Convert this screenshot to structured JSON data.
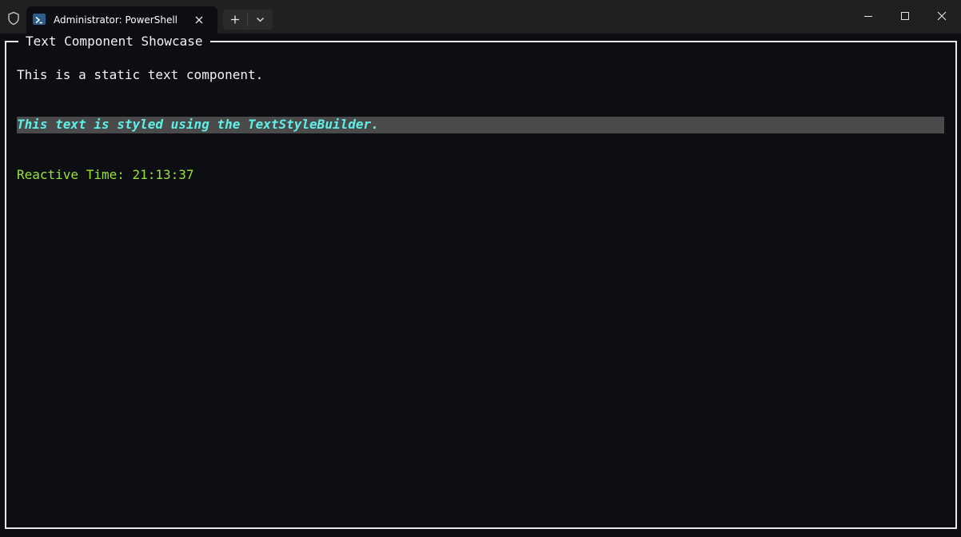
{
  "window": {
    "tab_title": "Administrator: PowerShell",
    "tab_icon": "powershell-icon",
    "controls": [
      "minimize-icon",
      "maximize-icon",
      "close-icon"
    ]
  },
  "terminal": {
    "frame_title": "Text Component Showcase",
    "static_text": "This is a static text component.",
    "styled_text": "This text is styled using the TextStyleBuilder.",
    "reactive_time": "Reactive Time: 21:13:37"
  },
  "colors": {
    "background": "#0c0e14",
    "titlebar": "#202020",
    "static_text": "#f2f2f2",
    "styled_text": "#5ef0e8",
    "styled_background": "#4a4a4a",
    "reactive_text": "#9ae03c",
    "frame_border": "#e8e8e8"
  }
}
